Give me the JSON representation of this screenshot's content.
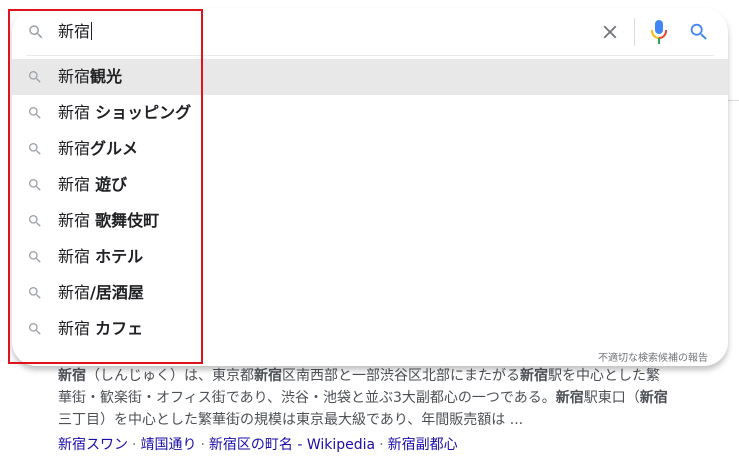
{
  "search": {
    "query": "新宿",
    "icons": {
      "search": "search-icon",
      "clear": "close-icon",
      "mic": "microphone-icon",
      "submit": "search-icon"
    },
    "mic_colors": [
      "#4285f4",
      "#ea4335",
      "#fbbc05",
      "#34a853"
    ]
  },
  "suggestions": [
    {
      "prefix": "新宿",
      "bold": "観光",
      "highlighted": true
    },
    {
      "prefix": "新宿 ",
      "bold": "ショッピング",
      "highlighted": false
    },
    {
      "prefix": "新宿",
      "bold": "グルメ",
      "highlighted": false
    },
    {
      "prefix": "新宿 ",
      "bold": "遊び",
      "highlighted": false
    },
    {
      "prefix": "新宿 ",
      "bold": "歌舞伎町",
      "highlighted": false
    },
    {
      "prefix": "新宿 ",
      "bold": "ホテル",
      "highlighted": false
    },
    {
      "prefix": "新宿",
      "bold": "/居酒屋",
      "highlighted": false
    },
    {
      "prefix": "新宿 ",
      "bold": "カフェ",
      "highlighted": false
    }
  ],
  "report_label": "不適切な検索候補の報告",
  "result": {
    "snippet_parts": [
      {
        "t": "新宿",
        "b": true
      },
      {
        "t": "（しんじゅく）は、東京都",
        "b": false
      },
      {
        "t": "新宿",
        "b": true
      },
      {
        "t": "区南西部と一部渋谷区北部にまたがる",
        "b": false
      },
      {
        "t": "新宿",
        "b": true
      },
      {
        "t": "駅を中心とした繁華街・歓楽街・オフィス街であり、渋谷・池袋と並ぶ3大副都心の一つである。",
        "b": false
      },
      {
        "t": "新宿",
        "b": true
      },
      {
        "t": "駅東口（",
        "b": false
      },
      {
        "t": "新宿",
        "b": true
      },
      {
        "t": "三丁目）を中心とした繁華街の規模は東京最大級であり、年間販売額は ...",
        "b": false
      }
    ],
    "sitelinks": [
      "新宿スワン",
      "靖国通り",
      "新宿区の町名 - Wikipedia",
      "新宿副都心"
    ],
    "sitelink_separator": "·"
  },
  "annotation_color": "#e0131c"
}
